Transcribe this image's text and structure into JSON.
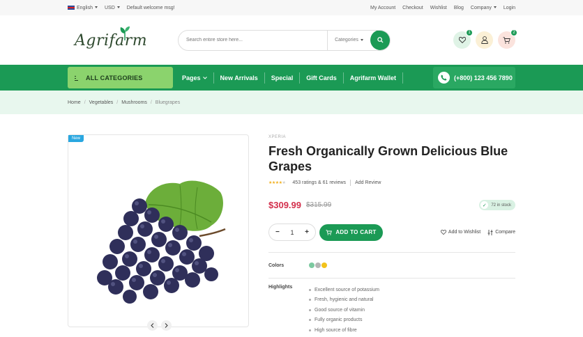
{
  "topbar": {
    "language": "English",
    "currency": "USD",
    "welcome": "Default welcome msg!",
    "links": [
      "My Account",
      "Checkout",
      "Wishlist",
      "Blog",
      "Company",
      "Login"
    ]
  },
  "header": {
    "logo_text": "Agrifarm",
    "search_placeholder": "Search entire store here...",
    "category_select": "Categories",
    "wishlist_count": "1",
    "cart_count": "2"
  },
  "nav": {
    "all_categories": "ALL CATEGORIES",
    "items": [
      "Pages",
      "New Arrivals",
      "Special",
      "Gift Cards",
      "Agrifarm Wallet"
    ],
    "phone": "(+800) 123 456 7890"
  },
  "breadcrumb": [
    "Home",
    "Vegetables",
    "Mushrooms",
    "Bluegrapes"
  ],
  "product": {
    "badge": "New",
    "brand": "XPERIA",
    "title": "Fresh Organically Grown Delicious Blue Grapes",
    "rating_stars": 4,
    "ratings_text": "453 ratings & 61 reviews",
    "add_review": "Add Review",
    "price": "$309.99",
    "old_price": "$315.99",
    "stock": "72 in stock",
    "quantity": "1",
    "add_to_cart": "ADD TO CART",
    "add_to_wishlist": "Add to Wishlist",
    "compare": "Compare",
    "colors_label": "Colors",
    "colors": [
      "#7cc9a0",
      "#b5b5b5",
      "#f2c21b"
    ],
    "highlights_label": "Highlights",
    "highlights": [
      "Excellent source of potassium",
      "Fresh, hygienic and natural",
      "Good source of vitamin",
      "Fully organic products",
      "High source of fibre"
    ]
  },
  "colors": {
    "primary": "#1b9a55",
    "accent": "#8bd36d",
    "price": "#d32f4c",
    "badge": "#2aa7e0"
  }
}
